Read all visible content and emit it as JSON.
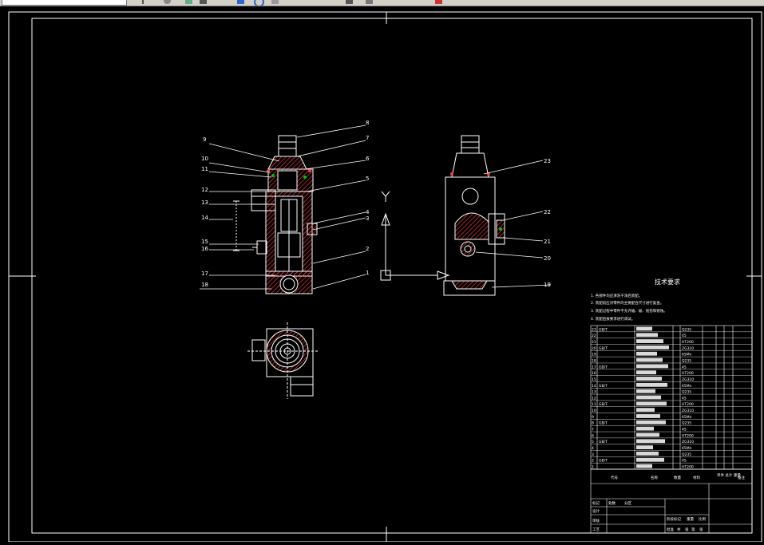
{
  "drawing": {
    "part_numbers_left": [
      "9",
      "10",
      "11",
      "12",
      "13",
      "14",
      "15",
      "16",
      "17",
      "18"
    ],
    "part_numbers_right_front": [
      "8",
      "7",
      "6",
      "5",
      "4",
      "3",
      "2",
      "1"
    ],
    "part_numbers_side": [
      "23",
      "22",
      "21",
      "20",
      "19"
    ],
    "axis_y_label": "Y",
    "tech_title": "技术要求",
    "tech_notes": [
      "1. 各部件均应清洗干净后装配。",
      "2. 装配前应对零件的主要配合尺寸进行复查。",
      "3. 装配过程中零件不允许磕、碰、划伤和锈蚀。",
      "4. 装配后按要求进行调试。"
    ],
    "bom_visible_texts": [
      "GB/T",
      "Q235",
      "45",
      "HT200",
      "ZG310",
      "65Mn"
    ],
    "title_block": {
      "col_code": "代号",
      "col_name": "名称",
      "col_qty": "数量",
      "col_material": "材料",
      "col_weight": "单件 总计 重量",
      "col_remark": "备注",
      "bottom_texts": [
        "标记",
        "处数",
        "分区",
        "设计",
        "审核",
        "工艺",
        "批准",
        "共",
        "张",
        "第",
        "张",
        "阶段标记",
        "重量",
        "比例"
      ]
    }
  },
  "colors": {
    "background": "#000000",
    "line": "#ffffff",
    "hatch": "#ff4040",
    "accent_green": "#00c000",
    "toolbar": "#d4d0c8"
  },
  "toolbar": {
    "icons": [
      "open-icon",
      "save-icon",
      "undo-icon",
      "redo-icon",
      "zoom-icon",
      "pan-icon",
      "layer-icon",
      "properties-icon",
      "print-icon",
      "help-icon"
    ]
  }
}
